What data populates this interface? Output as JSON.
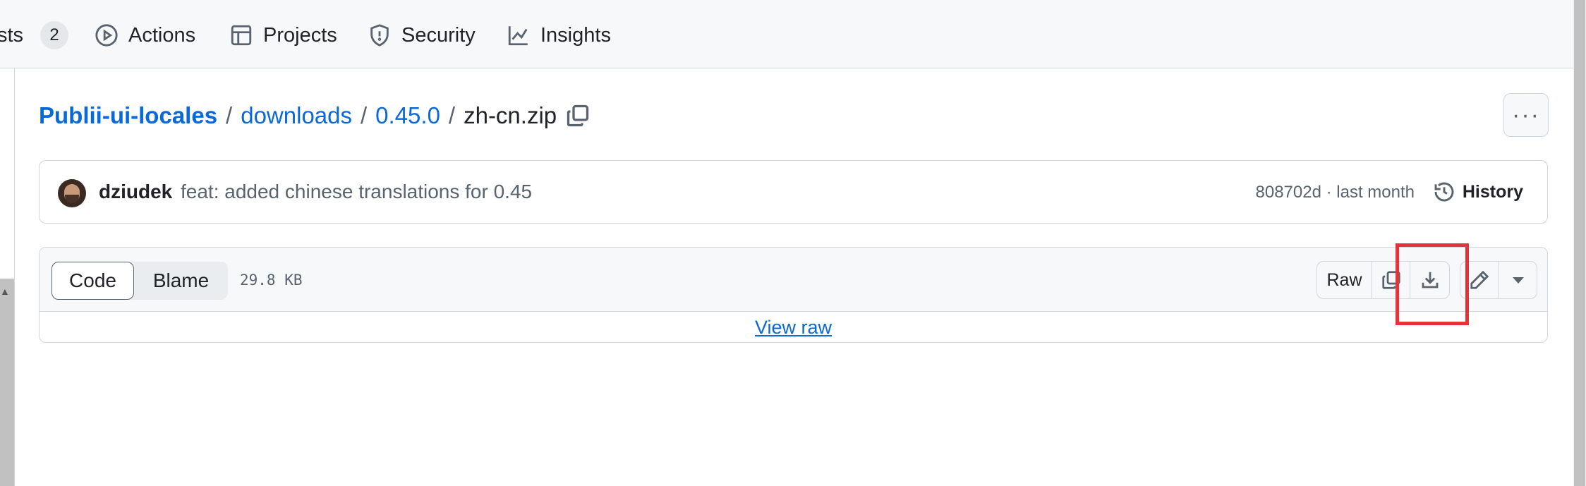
{
  "nav": {
    "items": [
      {
        "label": "sts",
        "badge": "2",
        "icon": "pull-request-icon"
      },
      {
        "label": "Actions",
        "icon": "play-circle-icon"
      },
      {
        "label": "Projects",
        "icon": "table-icon"
      },
      {
        "label": "Security",
        "icon": "shield-icon"
      },
      {
        "label": "Insights",
        "icon": "graph-icon"
      }
    ]
  },
  "breadcrumb": {
    "repo": "Publii-ui-locales",
    "folder1": "downloads",
    "folder2": "0.45.0",
    "file": "zh-cn.zip",
    "sep": "/"
  },
  "more_button": {
    "label": "···"
  },
  "commit": {
    "author": "dziudek",
    "message": "feat: added chinese translations for 0.45",
    "meta": "808702d · last month",
    "history_label": "History"
  },
  "file": {
    "tab_code": "Code",
    "tab_blame": "Blame",
    "size": "29.8 KB",
    "raw_label": "Raw",
    "view_raw": "View raw"
  },
  "colors": {
    "link": "#0969da",
    "highlight": "#e5333a",
    "border": "#d0d7de",
    "header_bg": "#f6f8fa"
  }
}
